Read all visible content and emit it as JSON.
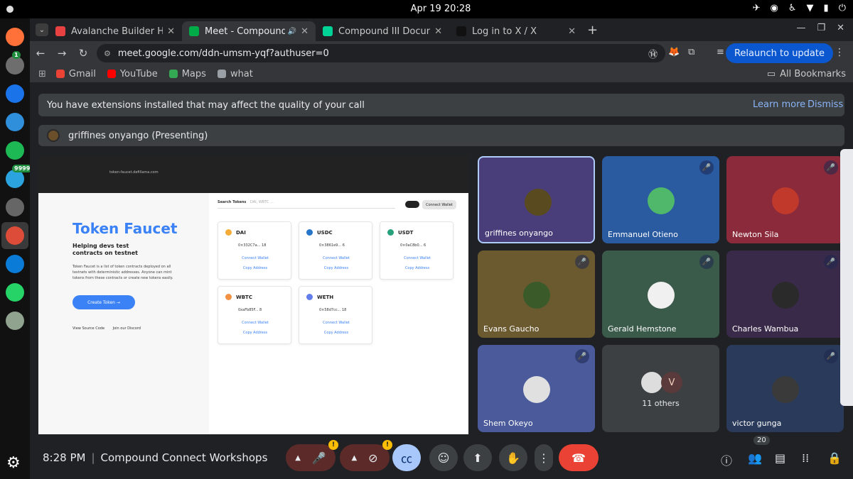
{
  "system": {
    "clock": "Apr 19  20:28",
    "tray_icons": [
      "telegram-icon",
      "chrome-icon",
      "accessibility-icon",
      "wifi-icon",
      "battery-icon",
      "power-icon"
    ]
  },
  "dock": {
    "apps": [
      {
        "name": "firefox-icon",
        "color": "#ff7139"
      },
      {
        "name": "files-icon",
        "color": "#6e6e6e",
        "badge": "1"
      },
      {
        "name": "writer-icon",
        "color": "#1a73e8"
      },
      {
        "name": "help-icon",
        "color": "#2f8fdb"
      },
      {
        "name": "spotify-icon",
        "color": "#1db954"
      },
      {
        "name": "telegram-icon",
        "color": "#2aa3df",
        "badge": "9999"
      },
      {
        "name": "settings-icon",
        "color": "#666666"
      },
      {
        "name": "chrome-icon",
        "color": "#dd4b39"
      },
      {
        "name": "vscode-icon",
        "color": "#0a7bd6"
      },
      {
        "name": "whatsapp-icon",
        "color": "#25d366"
      },
      {
        "name": "trash-icon",
        "color": "#8fa38f"
      }
    ]
  },
  "tabs": [
    {
      "label": "Avalanche Builder Hub",
      "color": "#e84142"
    },
    {
      "label": "Meet - Compound Co",
      "color": "#00ac47",
      "active": true
    },
    {
      "label": "Compound III Document",
      "color": "#00d395"
    },
    {
      "label": "Log in to X / X",
      "color": "#111111"
    }
  ],
  "toolbar": {
    "url": "meet.google.com/ddn-umsm-yqf?authuser=0",
    "relaunch": "Relaunch to update"
  },
  "bookmarks": [
    {
      "label": "Gmail",
      "color": "#ea4335"
    },
    {
      "label": "YouTube",
      "color": "#ff0000"
    },
    {
      "label": "Maps",
      "color": "#34a853"
    },
    {
      "label": "what",
      "color": "#9aa0a6"
    }
  ],
  "bookmarks_all": "All Bookmarks",
  "banner": {
    "text": "You have extensions installed that may affect the quality of your call",
    "learn_more": "Learn more",
    "dismiss": "Dismiss"
  },
  "presenter": {
    "label": "griffines onyango (Presenting)"
  },
  "shared_screen": {
    "url": "token-faucet.defillama.com",
    "title": "Token Faucet",
    "subtitle": "Helping devs test contracts on testnet",
    "description": "Token Faucet is a list of token contracts deployed on all testnets with deterministic addresses. Anyone can mint tokens from these contracts or create new tokens easily.",
    "cta": "Create Token →",
    "link_source": "View Source Code",
    "link_discord": "Join our Discord",
    "search_label": "Search Tokens",
    "search_placeholder": "DAI, WBTC ...",
    "connect": "Connect Wallet",
    "cards": [
      {
        "symbol": "DAI",
        "addr": "0×332C7a... 18",
        "color": "#f5ac37"
      },
      {
        "symbol": "USDC",
        "addr": "0×3861e9... 6",
        "color": "#2775ca"
      },
      {
        "symbol": "USDT",
        "addr": "0×0aC8b0... 6",
        "color": "#26a17b"
      },
      {
        "symbol": "WBTC",
        "addr": "0xaFb85F... 8",
        "color": "#f09242"
      },
      {
        "symbol": "WETH",
        "addr": "0×58d7cc... 18",
        "color": "#627eea"
      }
    ],
    "card_link_connect": "Connect Wallet",
    "card_link_copy": "Copy Address"
  },
  "participants": [
    {
      "name": "griffines onyango",
      "bg": "#4a3e7a",
      "avatar": "#5a4a20",
      "muted": false,
      "speaking": true
    },
    {
      "name": "Emmanuel Otieno",
      "bg": "#2a5aa0",
      "avatar": "#4fb86a",
      "muted": true
    },
    {
      "name": "Newton Sila",
      "bg": "#8a2a3a",
      "avatar": "#c0392b",
      "muted": true
    },
    {
      "name": "Evans Gaucho",
      "bg": "#6b5a30",
      "avatar": "#3a5a2a",
      "muted": true
    },
    {
      "name": "Gerald Hemstone",
      "bg": "#3a5a4a",
      "avatar": "#f0f0f0",
      "muted": true
    },
    {
      "name": "Charles Wambua",
      "bg": "#3a2a4a",
      "avatar": "#2a2a2a",
      "muted": true
    },
    {
      "name": "Shem Okeyo",
      "bg": "#4a5a9a",
      "avatar": "#e0e0e0",
      "muted": true
    },
    {
      "name": "victor gunga",
      "bg": "#2a3a5a",
      "avatar": "#3a3a3a",
      "muted": true
    }
  ],
  "others": {
    "count_label": "11 others",
    "initial": "V"
  },
  "meeting": {
    "time": "8:28 PM",
    "title": "Compound Connect Workshops"
  },
  "people_count": "20"
}
